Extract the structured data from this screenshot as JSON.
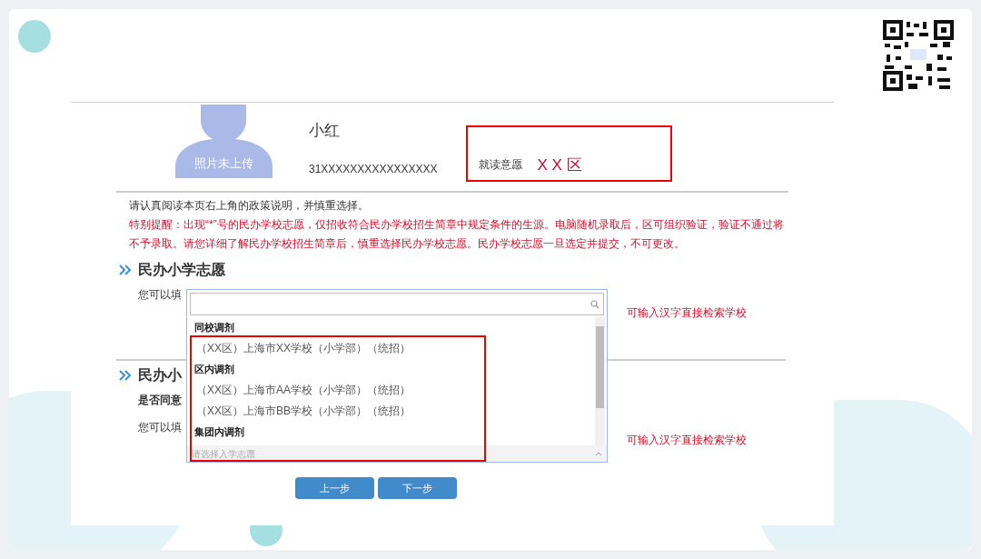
{
  "student": {
    "photo_label": "照片未上传",
    "name": "小红",
    "id_number": "31XXXXXXXXXXXXXXXX",
    "preference_label": "就读意愿",
    "preference_value": "X X 区"
  },
  "notice": {
    "text": "请认真阅读本页右上角的政策说明，并慎重选择。",
    "warning": "特别提醒：出现“*”号的民办学校志愿，仅招收符合民办学校招生简章中规定条件的生源。电脑随机录取后，区可组织验证，验证不通过将不予录取。请您详细了解民办学校招生简章后，慎重选择民办学校志愿。民办学校志愿一旦选定并提交，不可更改。"
  },
  "sections": [
    {
      "heading": "民办小学志愿",
      "lines": [
        "您可以填"
      ],
      "hint": "可输入汉字直接检索学校"
    },
    {
      "heading": "民办小",
      "lines": [
        "是否同意",
        "您可以填"
      ],
      "hint": "可输入汉字直接检索学校"
    }
  ],
  "dropdown": {
    "placeholder": "请选择入学志愿",
    "groups": [
      {
        "label": "同校调剂",
        "options": [
          "（XX区）上海市XX学校（小学部）（统招）"
        ]
      },
      {
        "label": "区内调剂",
        "options": [
          "（XX区）上海市AA学校（小学部）（统招）",
          "（XX区）上海市BB学校（小学部）（统招）"
        ]
      },
      {
        "label": "集团内调剂"
      }
    ]
  },
  "buttons": [
    "上一步",
    "下一步"
  ]
}
